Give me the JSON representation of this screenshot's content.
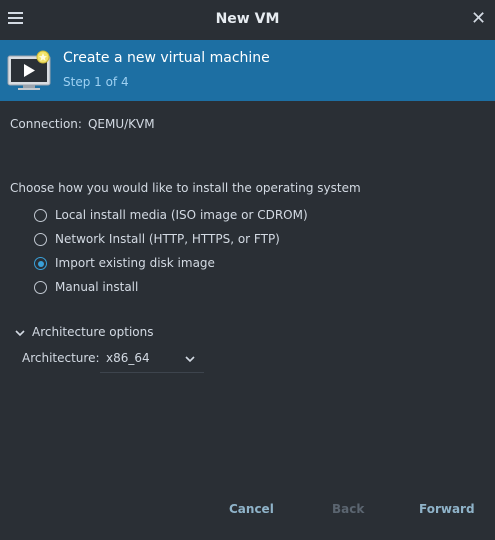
{
  "window": {
    "title": "New VM"
  },
  "header": {
    "title": "Create a new virtual machine",
    "step": "Step 1 of 4"
  },
  "connection": {
    "label": "Connection:",
    "value": "QEMU/KVM"
  },
  "install": {
    "question": "Choose how you would like to install the operating system",
    "options": [
      {
        "label": "Local install media (ISO image or CDROM)",
        "selected": false
      },
      {
        "label": "Network Install (HTTP, HTTPS, or FTP)",
        "selected": false
      },
      {
        "label": "Import existing disk image",
        "selected": true
      },
      {
        "label": "Manual install",
        "selected": false
      }
    ]
  },
  "architecture": {
    "expander_label": "Architecture options",
    "label": "Architecture:",
    "value": "x86_64"
  },
  "buttons": {
    "cancel": "Cancel",
    "back": "Back",
    "forward": "Forward"
  },
  "colors": {
    "header_bg": "#1d6fa3",
    "accent": "#3aa0d8",
    "window_bg": "#2a2f35"
  },
  "icons": [
    "menu-icon",
    "close-icon",
    "vm-monitor-icon",
    "chevron-down-icon"
  ]
}
